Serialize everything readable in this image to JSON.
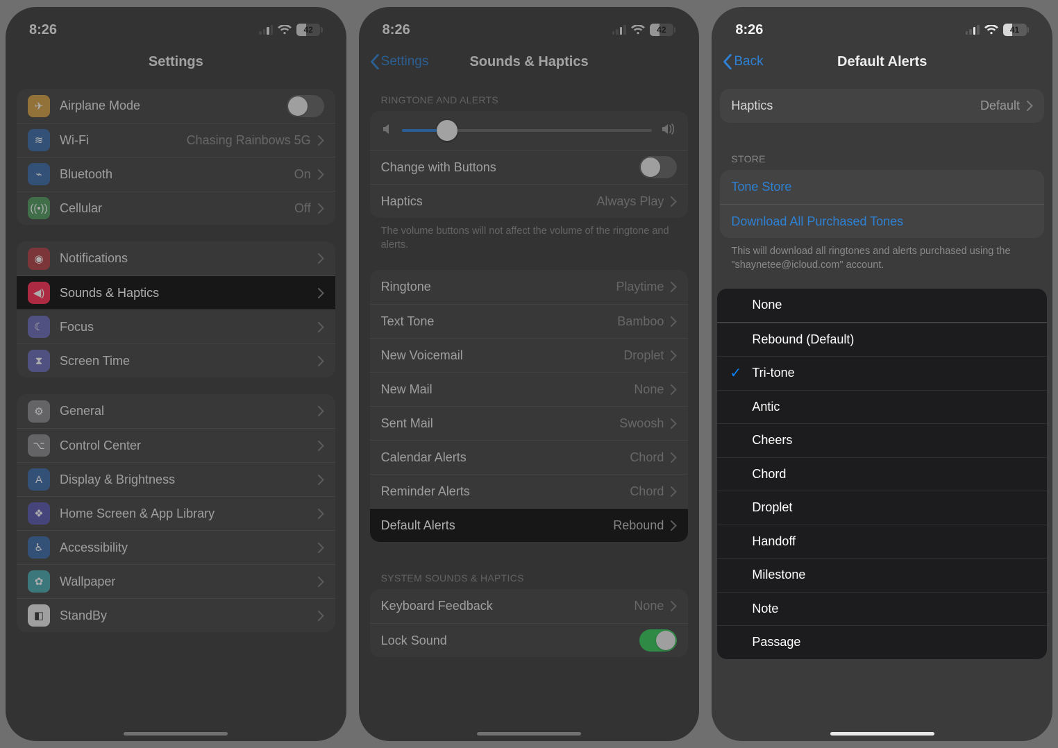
{
  "phone1": {
    "time": "8:26",
    "battery": "42",
    "battery_pct": 42,
    "title": "Settings",
    "group1": [
      {
        "name": "airplane",
        "label": "Airplane Mode",
        "icon_bg": "#d6a044",
        "toggle_on": false,
        "has_toggle": true
      },
      {
        "name": "wifi",
        "label": "Wi-Fi",
        "icon_bg": "#3a6aa8",
        "value": "Chasing Rainbows 5G"
      },
      {
        "name": "bluetooth",
        "label": "Bluetooth",
        "icon_bg": "#3a6aa8",
        "value": "On"
      },
      {
        "name": "cellular",
        "label": "Cellular",
        "icon_bg": "#4e9a5c",
        "value": "Off"
      }
    ],
    "group2": [
      {
        "name": "notifications",
        "label": "Notifications",
        "icon_bg": "#b14044"
      },
      {
        "name": "sounds",
        "label": "Sounds & Haptics",
        "icon_bg": "#ff2d55",
        "highlight": true
      },
      {
        "name": "focus",
        "label": "Focus",
        "icon_bg": "#6b6bb8"
      },
      {
        "name": "screentime",
        "label": "Screen Time",
        "icon_bg": "#6b6bb8"
      }
    ],
    "group3": [
      {
        "name": "general",
        "label": "General",
        "icon_bg": "#8a8a8e"
      },
      {
        "name": "controlcenter",
        "label": "Control Center",
        "icon_bg": "#8a8a8e"
      },
      {
        "name": "display",
        "label": "Display & Brightness",
        "icon_bg": "#3a6aa8"
      },
      {
        "name": "homescreen",
        "label": "Home Screen & App Library",
        "icon_bg": "#5757b0"
      },
      {
        "name": "accessibility",
        "label": "Accessibility",
        "icon_bg": "#3a6aa8"
      },
      {
        "name": "wallpaper",
        "label": "Wallpaper",
        "icon_bg": "#4aa8b0"
      },
      {
        "name": "standby",
        "label": "StandBy",
        "icon_bg": "#e8e8e8"
      }
    ]
  },
  "phone2": {
    "time": "8:26",
    "battery": "42",
    "battery_pct": 42,
    "back": "Settings",
    "title": "Sounds & Haptics",
    "hdr1": "RINGTONE AND ALERTS",
    "volume_pct": 18,
    "change_buttons_label": "Change with Buttons",
    "change_buttons_on": false,
    "haptics_label": "Haptics",
    "haptics_value": "Always Play",
    "foot1": "The volume buttons will not affect the volume of the ringtone and alerts.",
    "tones": [
      {
        "name": "ringtone",
        "label": "Ringtone",
        "value": "Playtime"
      },
      {
        "name": "texttone",
        "label": "Text Tone",
        "value": "Bamboo"
      },
      {
        "name": "voicemail",
        "label": "New Voicemail",
        "value": "Droplet"
      },
      {
        "name": "newmail",
        "label": "New Mail",
        "value": "None"
      },
      {
        "name": "sentmail",
        "label": "Sent Mail",
        "value": "Swoosh"
      },
      {
        "name": "calendar",
        "label": "Calendar Alerts",
        "value": "Chord"
      },
      {
        "name": "reminder",
        "label": "Reminder Alerts",
        "value": "Chord"
      },
      {
        "name": "default",
        "label": "Default Alerts",
        "value": "Rebound",
        "highlight": true
      }
    ],
    "hdr2": "SYSTEM SOUNDS & HAPTICS",
    "sys": [
      {
        "name": "keyboard",
        "label": "Keyboard Feedback",
        "value": "None"
      },
      {
        "name": "lock",
        "label": "Lock Sound",
        "toggle_on": true,
        "has_toggle": true
      }
    ]
  },
  "phone3": {
    "time": "8:26",
    "battery": "41",
    "battery_pct": 41,
    "back": "Back",
    "title": "Default Alerts",
    "haptics_label": "Haptics",
    "haptics_value": "Default",
    "hdr_store": "STORE",
    "store": [
      {
        "name": "tonestore",
        "label": "Tone Store"
      },
      {
        "name": "download",
        "label": "Download All Purchased Tones"
      }
    ],
    "store_foot": "This will download all ringtones and alerts purchased using the \"shaynetee@icloud.com\" account.",
    "tones": [
      {
        "label": "None",
        "sep_after": true
      },
      {
        "label": "Rebound (Default)"
      },
      {
        "label": "Tri-tone",
        "checked": true
      },
      {
        "label": "Antic"
      },
      {
        "label": "Cheers"
      },
      {
        "label": "Chord"
      },
      {
        "label": "Droplet"
      },
      {
        "label": "Handoff"
      },
      {
        "label": "Milestone"
      },
      {
        "label": "Note"
      },
      {
        "label": "Passage"
      }
    ]
  }
}
